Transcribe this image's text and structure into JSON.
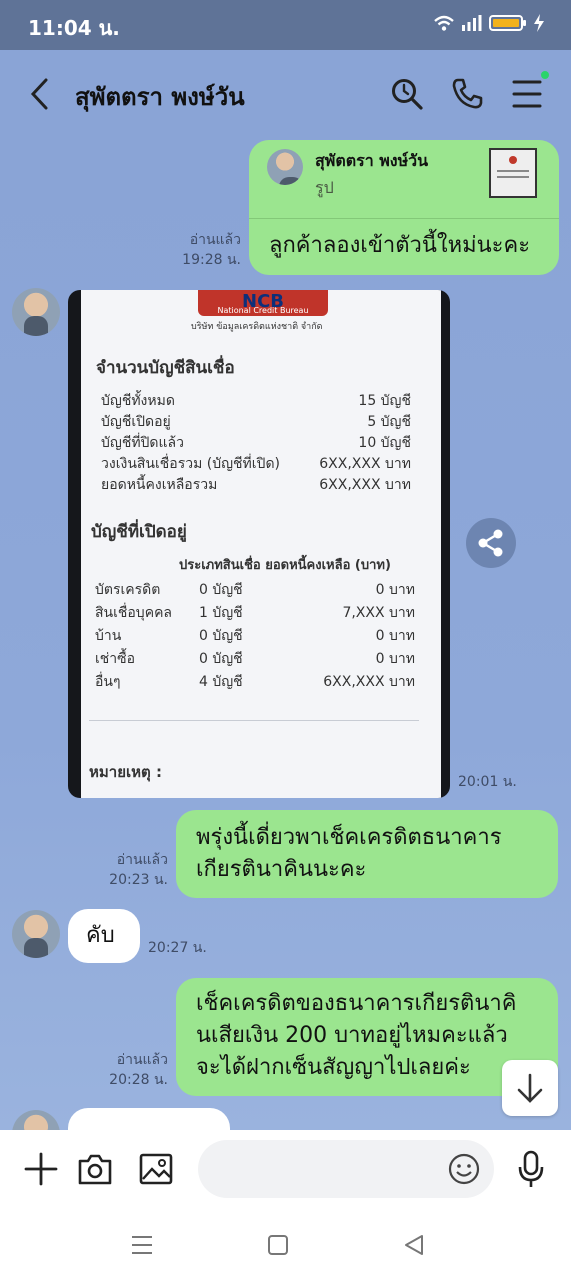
{
  "status_bar": {
    "time": "11:04 น."
  },
  "header": {
    "title": "สุพัตตรา พงษ์วัน"
  },
  "messages": {
    "reply": {
      "sender": "สุพัตตรา พงษ์วัน",
      "type": "รูป",
      "text": "ลูกค้าลองเข้าตัวนี้ใหม่นะคะ",
      "read": "อ่านแล้ว",
      "time": "19:28 น."
    },
    "photo_time": "20:01 น.",
    "msg2": {
      "lines": [
        "พรุ่งนี้เดี่ยวพาเช็คเครดิตธนาคาร",
        "เกียรตินาคินนะคะ"
      ],
      "read": "อ่านแล้ว",
      "time": "20:23 น."
    },
    "msg3": {
      "text": "คับ",
      "time": "20:27 น."
    },
    "msg4": {
      "lines": [
        "เช็คเครดิตของธนาคารเกียรตินาคิ",
        "นเสียเงิน 200 บาทอยู่ไหมคะแล้ว",
        "จะได้ฝากเซ็นสัญญาไปเลยค่ะ"
      ],
      "read": "อ่านแล้ว",
      "time": "20:28 น."
    }
  },
  "doc": {
    "logo": "NCB",
    "logo_sub": "National Credit Bureau",
    "company": "บริษัท ข้อมูลเครดิตแห่งชาติ จำกัด",
    "section1": "จำนวนบัญชีสินเชื่อ",
    "rows1": [
      {
        "label": "บัญชีทั้งหมด",
        "value": "15 บัญชี"
      },
      {
        "label": "บัญชีเปิดอยู่",
        "value": "5 บัญชี"
      },
      {
        "label": "บัญชีที่ปิดแล้ว",
        "value": "10 บัญชี"
      },
      {
        "label": "วงเงินสินเชื่อรวม (บัญชีที่เปิด)",
        "value": "6XX,XXX บาท"
      },
      {
        "label": "ยอดหนี้คงเหลือรวม",
        "value": "6XX,XXX บาท"
      }
    ],
    "section2": "บัญชีที่เปิดอยู่",
    "table_header": "ประเภทสินเชื่อ ยอดหนี้คงเหลือ (บาท)",
    "rows2": [
      {
        "type": "บัตรเครดิต",
        "count": "0 บัญชี",
        "amount": "0 บาท"
      },
      {
        "type": "สินเชื่อบุคคล",
        "count": "1 บัญชี",
        "amount": "7,XXX บาท"
      },
      {
        "type": "บ้าน",
        "count": "0 บัญชี",
        "amount": "0 บาท"
      },
      {
        "type": "เช่าซื้อ",
        "count": "0 บัญชี",
        "amount": "0 บาท"
      },
      {
        "type": "อื่นๆ",
        "count": "4 บัญชี",
        "amount": "6XX,XXX บาท"
      }
    ],
    "note": "หมายเหตุ :"
  },
  "colors": {
    "accent_green": "#9be58f",
    "status_dot": "#2bd46b"
  }
}
